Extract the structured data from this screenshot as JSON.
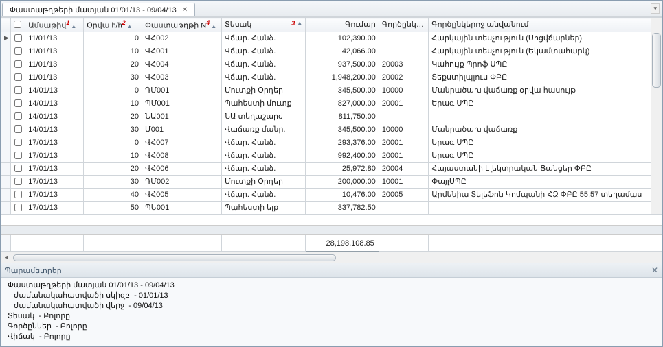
{
  "tab": {
    "title": "Փաստաթղթերի մատյան 01/01/13 - 09/04/13"
  },
  "columns": {
    "date": "Ամսաթիվ",
    "date_sort": "1",
    "day": "Օրվա h/h",
    "day_sort": "2",
    "docnum": "Փաստաթղթի N",
    "docnum_sort": "4",
    "type": "Տեսակ",
    "type_sort": "3",
    "amount": "Գումար",
    "partner": "Գործընկեր",
    "partner_name": "Գործընկերոջ անվանում"
  },
  "rows": [
    {
      "marker": "▶",
      "date": "11/01/13",
      "day": "0",
      "doc": "ՎՀ002",
      "type": "Վճար. Հանձ.",
      "amount": "102,390.00",
      "partner": "",
      "name": "Հարկային տեսչություն (Սոցվճարներ)"
    },
    {
      "marker": "",
      "date": "11/01/13",
      "day": "10",
      "doc": "ՎՀ001",
      "type": "Վճար. Հանձ.",
      "amount": "42,066.00",
      "partner": "",
      "name": "Հարկային տեսչություն (Եկամտահարկ)"
    },
    {
      "marker": "",
      "date": "11/01/13",
      "day": "20",
      "doc": "ՎՀ004",
      "type": "Վճար. Հանձ.",
      "amount": "937,500.00",
      "partner": "20003",
      "name": "Կահույք Պրոֆ ՍՊԸ"
    },
    {
      "marker": "",
      "date": "11/01/13",
      "day": "30",
      "doc": "ՎՀ003",
      "type": "Վճար. Հանձ.",
      "amount": "1,948,200.00",
      "partner": "20002",
      "name": "Տեքստիլպլուս ՓԲԸ"
    },
    {
      "marker": "",
      "date": "14/01/13",
      "day": "0",
      "doc": "ԴՄ001",
      "type": "Մուտքի Օրդեր",
      "amount": "345,500.00",
      "partner": "10000",
      "name": "Մանրածախ վաճառք օրվա հասույթ"
    },
    {
      "marker": "",
      "date": "14/01/13",
      "day": "10",
      "doc": "ՊՄ001",
      "type": "Պահեստի մուտք",
      "amount": "827,000.00",
      "partner": "20001",
      "name": "Երագ ՍՊԸ"
    },
    {
      "marker": "",
      "date": "14/01/13",
      "day": "20",
      "doc": "ՆԱ001",
      "type": "ՆԱ տեղաշարժ",
      "amount": "811,750.00",
      "partner": "",
      "name": ""
    },
    {
      "marker": "",
      "date": "14/01/13",
      "day": "30",
      "doc": "Մ001",
      "type": "Վաճառք մանր.",
      "amount": "345,500.00",
      "partner": "10000",
      "name": "Մանրածախ վաճառք"
    },
    {
      "marker": "",
      "date": "17/01/13",
      "day": "0",
      "doc": "ՎՀ007",
      "type": "Վճար. Հանձ.",
      "amount": "293,376.00",
      "partner": "20001",
      "name": "Երագ ՍՊԸ"
    },
    {
      "marker": "",
      "date": "17/01/13",
      "day": "10",
      "doc": "ՎՀ008",
      "type": "Վճար. Հանձ.",
      "amount": "992,400.00",
      "partner": "20001",
      "name": "Երագ ՍՊԸ"
    },
    {
      "marker": "",
      "date": "17/01/13",
      "day": "20",
      "doc": "ՎՀ006",
      "type": "Վճար. Հանձ.",
      "amount": "25,972.80",
      "partner": "20004",
      "name": "Հայաստանի Էլեկտրական Ցանցեր ՓԲԸ"
    },
    {
      "marker": "",
      "date": "17/01/13",
      "day": "30",
      "doc": "ԴՄ002",
      "type": "Մուտքի Օրդեր",
      "amount": "200,000.00",
      "partner": "10001",
      "name": "ՓայլՍՊԸ"
    },
    {
      "marker": "",
      "date": "17/01/13",
      "day": "40",
      "doc": "ՎՀ005",
      "type": "Վճար. Հանձ.",
      "amount": "10,476.00",
      "partner": "20005",
      "name": "Արմենիա Տելեֆոն Կոմպանի ՀՁ ՓԲԸ 55,57 տեղամաս"
    },
    {
      "marker": "",
      "date": "17/01/13",
      "day": "50",
      "doc": "ՊԵ001",
      "type": "Պահեստի ելք",
      "amount": "337,782.50",
      "partner": "",
      "name": ""
    }
  ],
  "total": "28,198,108.85",
  "params": {
    "title": "Պարամետրեր",
    "lines": [
      "Փաստաթղթերի մատյան 01/01/13 - 09/04/13",
      "   ժամանակահատվածի սկիզբ  - 01/01/13",
      "   ժամանակահատվածի վերջ  - 09/04/13",
      "Տեսակ  - Բոլորը",
      "Գործընկեր  - Բոլորը",
      "Վիճակ  - Բոլորը"
    ]
  }
}
